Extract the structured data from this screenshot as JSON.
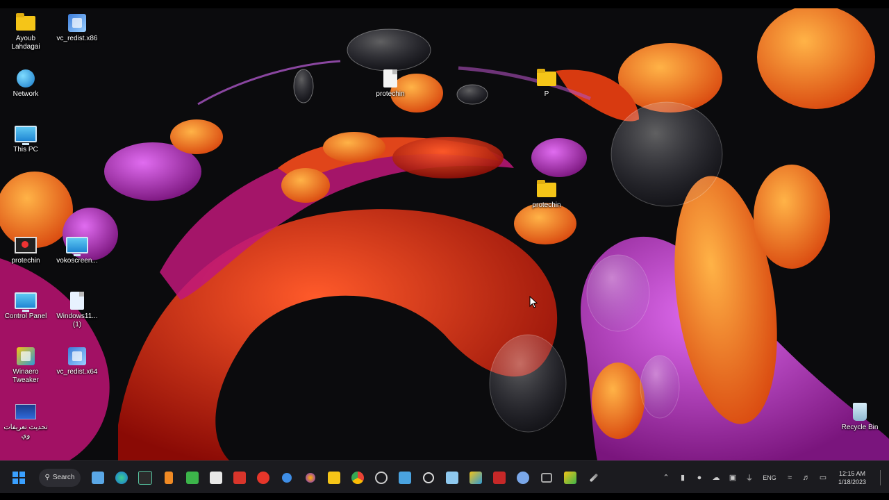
{
  "desktop": {
    "icons": [
      {
        "id": "ayoub",
        "label": "Ayoub Lahdagai"
      },
      {
        "id": "vcredist1",
        "label": "vc_redist.x86"
      },
      {
        "id": "network",
        "label": "Network"
      },
      {
        "id": "thispc",
        "label": "This PC"
      },
      {
        "id": "printer_file",
        "label": "protechin"
      },
      {
        "id": "folder_p",
        "label": "P"
      },
      {
        "id": "folder_pro",
        "label": "protechin"
      },
      {
        "id": "pc_red",
        "label": "protechin"
      },
      {
        "id": "vokoscreen",
        "label": "vokoscreen..."
      },
      {
        "id": "control_panel",
        "label": "Control Panel"
      },
      {
        "id": "windows11",
        "label": "Windows11... (1)"
      },
      {
        "id": "winaero",
        "label": "Winaero Tweaker"
      },
      {
        "id": "vcredist2",
        "label": "vc_redist.x64"
      },
      {
        "id": "arabic",
        "label": "تحديث تعريفات وي"
      },
      {
        "id": "recycle",
        "label": "Recycle Bin"
      }
    ]
  },
  "taskbar": {
    "search_label": "Search",
    "apps": [
      "file-explorer",
      "edge",
      "terminal",
      "app-orange",
      "camtasia",
      "store",
      "app-red",
      "record",
      "app-blue-dot",
      "firefox",
      "folder",
      "chrome",
      "settings",
      "photos",
      "snipping",
      "image-viewer",
      "notepad",
      "app-red-2",
      "app-blue",
      "video",
      "winaero",
      "tool"
    ],
    "tray_lang": "ENG",
    "time": "12:15 AM",
    "date": "1/18/2023"
  }
}
